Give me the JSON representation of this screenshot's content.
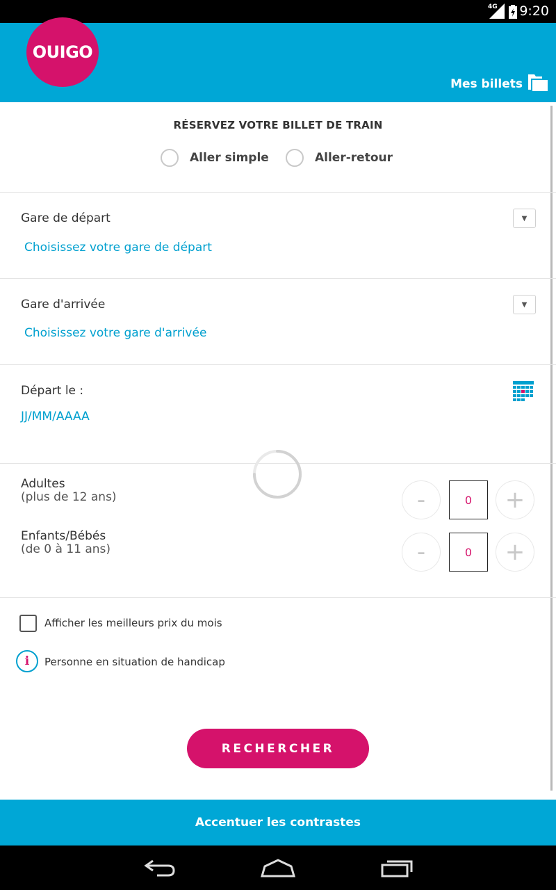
{
  "status_bar": {
    "network": "4G",
    "clock": "9:20"
  },
  "header": {
    "logo_text": "OUIGO",
    "my_tickets_label": "Mes billets"
  },
  "booking": {
    "title": "RÉSERVEZ VOTRE BILLET DE TRAIN",
    "trip_options": [
      "Aller simple",
      "Aller-retour"
    ]
  },
  "departure_station": {
    "label": "Gare de départ",
    "placeholder": "Choisissez votre gare de départ"
  },
  "arrival_station": {
    "label": "Gare d'arrivée",
    "placeholder": "Choisissez votre gare d'arrivée"
  },
  "date": {
    "label": "Départ le :",
    "placeholder": "JJ/MM/AAAA"
  },
  "passengers": {
    "adults": {
      "label": "Adultes",
      "sublabel": "(plus de 12 ans)",
      "count": "0"
    },
    "children": {
      "label": "Enfants/Bébés",
      "sublabel": "(de 0 à 11 ans)",
      "count": "0"
    },
    "minus": "-",
    "plus": "+"
  },
  "options": {
    "best_prices_label": "Afficher les meilleurs prix du mois",
    "best_prices_checked": false,
    "handicap_label": "Personne en situation de handicap",
    "info_glyph": "i"
  },
  "search_button": "RECHERCHER",
  "contrast_button": "Accentuer les contrastes",
  "colors": {
    "brand_pink": "#d5126b",
    "brand_blue": "#00a7d6",
    "link_blue": "#00a0cf"
  },
  "icons": [
    "signal-icon",
    "battery-icon",
    "folder-icon",
    "chevron-down-icon",
    "calendar-icon",
    "loading-spinner-icon",
    "info-icon",
    "back-icon",
    "home-icon",
    "recents-icon"
  ]
}
